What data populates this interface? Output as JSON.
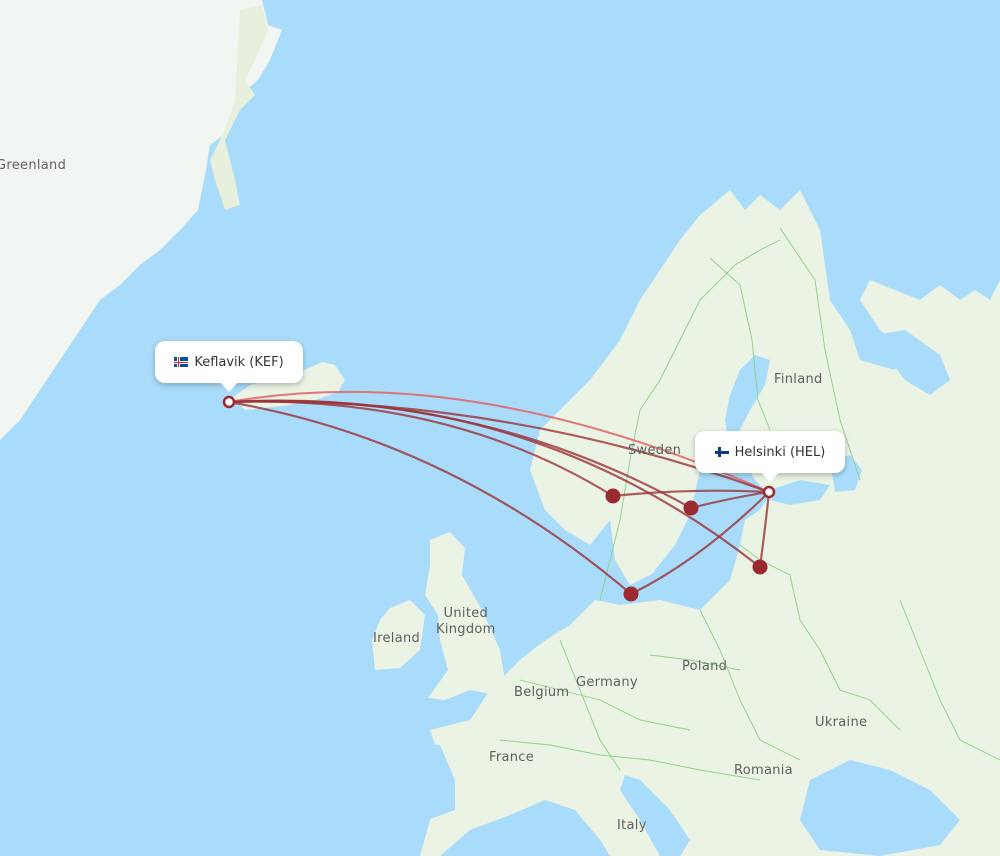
{
  "map": {
    "colors": {
      "water": "#a9dcfa",
      "land": "#eaf3e4",
      "ice": "#f1f6f2",
      "border": "#8fcf8a",
      "route": "#9b3339",
      "route_highlight": "#e0676d",
      "stop_marker": "#9b2a2e"
    },
    "country_labels": [
      {
        "id": "greenland",
        "text": "Greenland"
      },
      {
        "id": "finland",
        "text": "Finland"
      },
      {
        "id": "sweden",
        "text": "Sweden"
      },
      {
        "id": "united-kingdom",
        "text": "United\nKingdom"
      },
      {
        "id": "ireland",
        "text": "Ireland"
      },
      {
        "id": "belgium",
        "text": "Belgium"
      },
      {
        "id": "germany",
        "text": "Germany"
      },
      {
        "id": "poland",
        "text": "Poland"
      },
      {
        "id": "france",
        "text": "France"
      },
      {
        "id": "ukraine",
        "text": "Ukraine"
      },
      {
        "id": "romania",
        "text": "Romania"
      },
      {
        "id": "italy",
        "text": "Italy"
      }
    ],
    "airports": {
      "origin": {
        "code": "KEF",
        "label": "Keflavik (KEF)",
        "flag": "iceland-flag-icon"
      },
      "destination": {
        "code": "HEL",
        "label": "Helsinki (HEL)",
        "flag": "finland-flag-icon"
      }
    },
    "stopovers": [
      {
        "id": "stop-oslo"
      },
      {
        "id": "stop-stockholm"
      },
      {
        "id": "stop-riga"
      },
      {
        "id": "stop-copenhagen"
      }
    ],
    "routes": [
      {
        "id": "direct",
        "from": "KEF",
        "to": "HEL",
        "highlight": true
      },
      {
        "id": "via-oslo",
        "from": "KEF",
        "via": "stop-oslo",
        "to": "HEL"
      },
      {
        "id": "via-stockholm",
        "from": "KEF",
        "via": "stop-stockholm",
        "to": "HEL"
      },
      {
        "id": "via-riga",
        "from": "KEF",
        "via": "stop-riga",
        "to": "HEL"
      },
      {
        "id": "via-copenhagen",
        "from": "KEF",
        "via": "stop-copenhagen",
        "to": "HEL"
      }
    ]
  }
}
